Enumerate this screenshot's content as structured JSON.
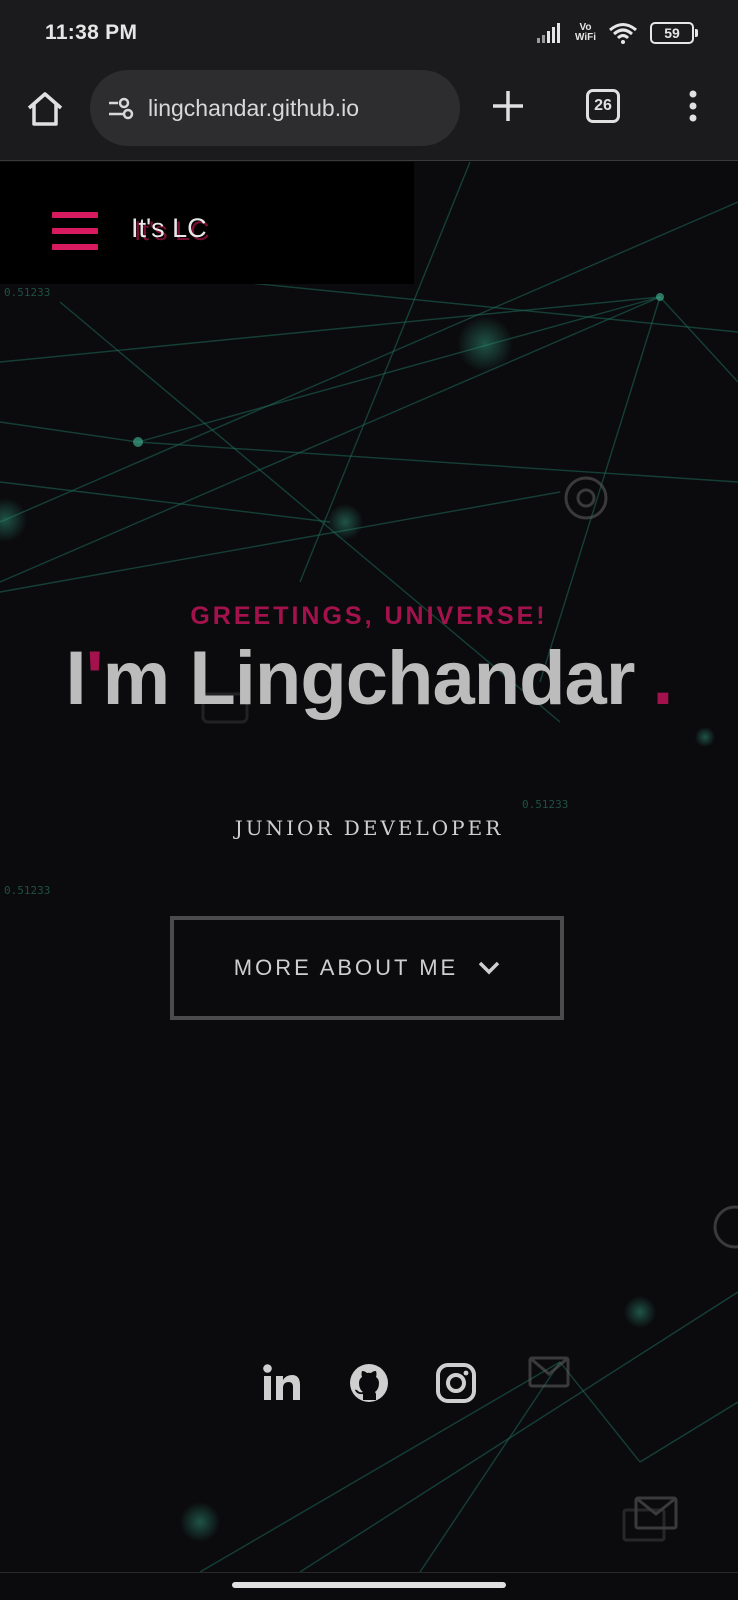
{
  "status": {
    "time": "11:38 PM",
    "vowifi_top": "Vo",
    "vowifi_bottom": "WiFi",
    "battery": "59"
  },
  "browser": {
    "url": "lingchandar.github.io",
    "tab_count": "26"
  },
  "nav": {
    "brand": "It's LC"
  },
  "hero": {
    "greeting": "GREETINGS, UNIVERSE!",
    "name_prefix": "I",
    "name_apostrophe": "'",
    "name_rest": "m Lingchandar",
    "name_dot": ".",
    "role": "JUNIOR DEVELOPER",
    "cta": "MORE ABOUT ME"
  },
  "background_labels": [
    "0.51233",
    "0.51233",
    "0.51233"
  ],
  "social": [
    "linkedin-icon",
    "github-icon",
    "instagram-icon"
  ],
  "colors": {
    "accent": "#a3124c",
    "menu_accent": "#d81b60",
    "page_bg": "#0b0b0d",
    "network_lines": "#1f6b58"
  }
}
